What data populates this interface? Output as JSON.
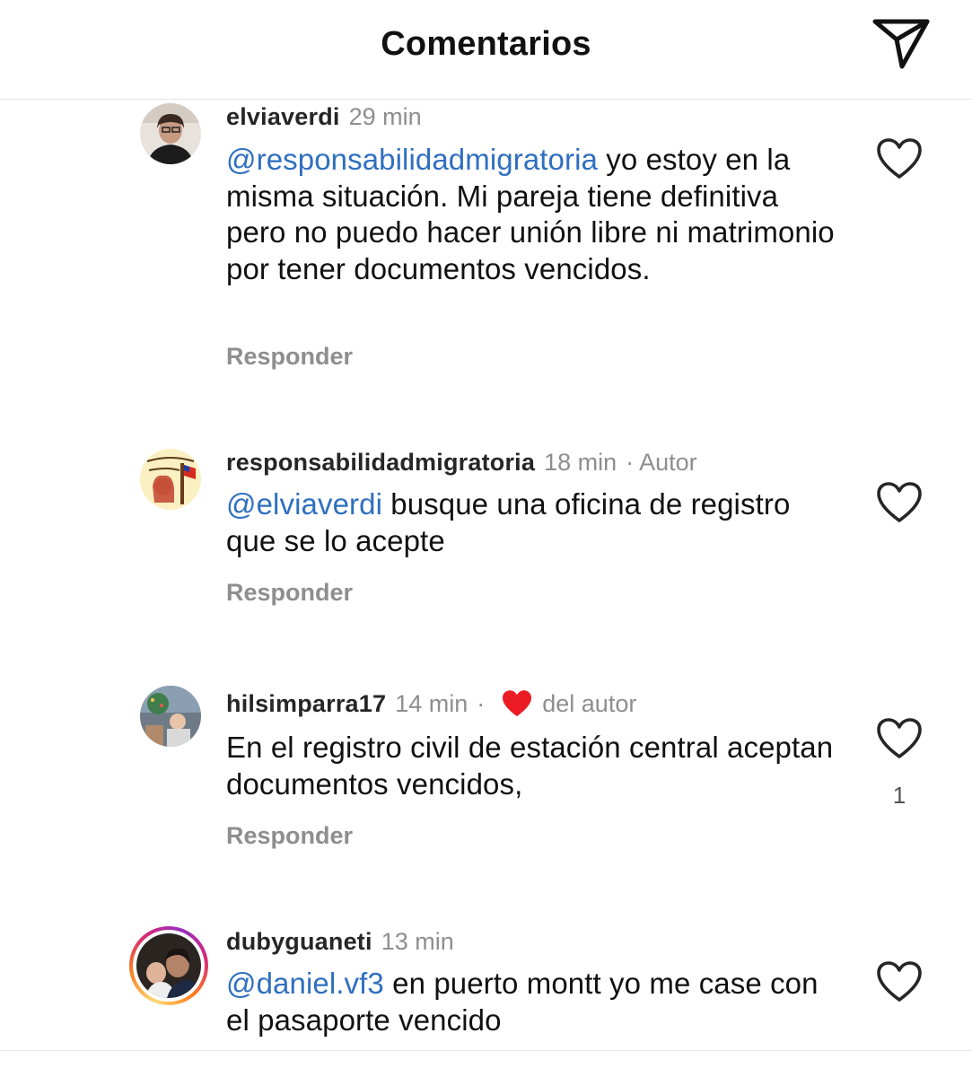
{
  "header": {
    "title": "Comentarios",
    "share_icon": "paper-plane-icon"
  },
  "comments": [
    {
      "username": "elviaverdi",
      "time": "29 min",
      "mention": "@responsabilidadmigratoria",
      "text": " yo estoy en la misma situación. Mi pareja tiene definitiva pero no puedo hacer unión libre ni matrimonio por tener documentos vencidos.",
      "reply_label": "Responder"
    },
    {
      "username": "responsabilidadmigratoria",
      "time": "18 min",
      "separator": "·",
      "author_label": "Autor",
      "mention": "@elviaverdi",
      "text": " busque una oficina de registro que se lo acepte",
      "reply_label": "Responder"
    },
    {
      "username": "hilsimparra17",
      "time": "14 min",
      "separator": "·",
      "liked_by_author_label": "del autor",
      "text": "En el registro civil de estación central aceptan documentos vencidos,",
      "reply_label": "Responder",
      "like_count": "1"
    },
    {
      "username": "dubyguaneti",
      "time": "13 min",
      "mention": "@daniel.vf3",
      "text": " en puerto montt yo me case con el pasaporte vencido"
    }
  ],
  "colors": {
    "mention": "#2f6fc0",
    "heart_red": "#ed1c24",
    "meta_gray": "#8e8e8e"
  }
}
